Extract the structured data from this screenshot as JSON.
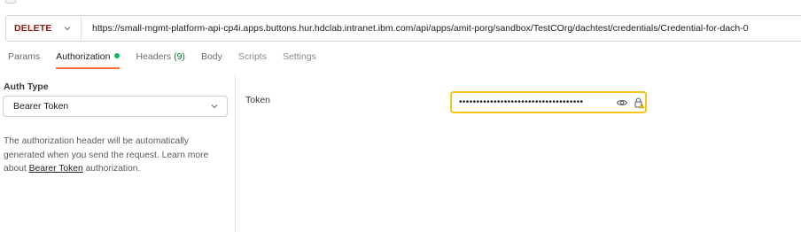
{
  "request": {
    "method": "DELETE",
    "url": "https://small-mgmt-platform-api-cp4i.apps.buttons.hur.hdclab.intranet.ibm.com/api/apps/amit-porg/sandbox/TestCOrg/dachtest/credentials/Credential-for-dach-0"
  },
  "tabs": [
    {
      "label": "Params"
    },
    {
      "label": "Authorization"
    },
    {
      "label": "Headers "
    },
    {
      "label": "Body"
    },
    {
      "label": "Scripts"
    },
    {
      "label": "Settings"
    }
  ],
  "headers_count": "(9)",
  "auth": {
    "type_label": "Auth Type",
    "type_value": "Bearer Token",
    "description_before": "The authorization header will be automatically generated when you send the request. Learn more about ",
    "description_link": "Bearer Token",
    "description_after": " authorization."
  },
  "token": {
    "label": "Token",
    "masked_value": "••••••••••••••••••••••••••••••••••••"
  },
  "colors": {
    "method": "#8e1a10",
    "active_tab_underline": "#ff6c37",
    "status_dot": "#0cbb52",
    "token_border": "#f7c417"
  }
}
